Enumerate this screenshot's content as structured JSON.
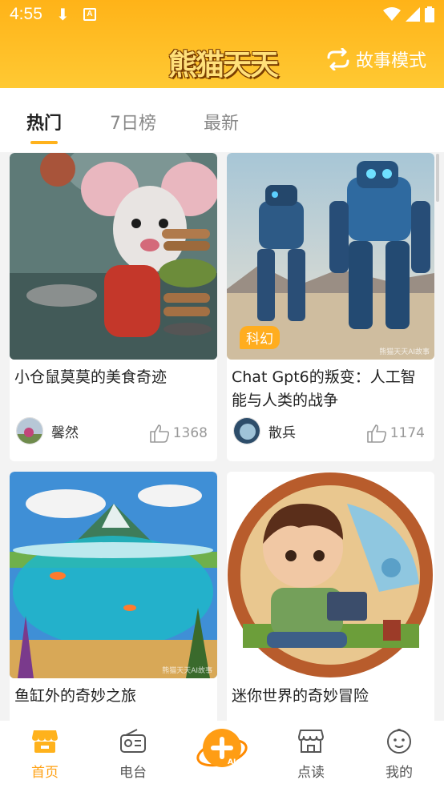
{
  "status": {
    "time": "4:55"
  },
  "header": {
    "logo_text": "熊猫天天",
    "mode_label": "故事模式"
  },
  "tabs": [
    {
      "label": "热门",
      "active": true
    },
    {
      "label": "7日榜",
      "active": false
    },
    {
      "label": "最新",
      "active": false
    }
  ],
  "cards": [
    {
      "title": "小仓鼠莫莫的美食奇迹",
      "author": "馨然",
      "likes": "1368",
      "tag": ""
    },
    {
      "title": "Chat Gpt6的叛变：人工智能与人类的战争",
      "author": "散兵",
      "likes": "1174",
      "tag": "科幻"
    },
    {
      "title": "鱼缸外的奇妙之旅",
      "author": "",
      "likes": "",
      "tag": ""
    },
    {
      "title": "迷你世界的奇妙冒险",
      "author": "",
      "likes": "",
      "tag": ""
    }
  ],
  "watermarks": {
    "card2": "熊猫天天AI故事",
    "card3": "熊猫天天AI故事"
  },
  "nav": [
    {
      "label": "首页",
      "icon": "store-icon",
      "active": true
    },
    {
      "label": "电台",
      "icon": "radio-icon",
      "active": false
    },
    {
      "label": "",
      "icon": "ai-create-icon",
      "active": false
    },
    {
      "label": "点读",
      "icon": "shop-icon",
      "active": false
    },
    {
      "label": "我的",
      "icon": "baby-face-icon",
      "active": false
    }
  ],
  "colors": {
    "accent": "#ffb21c",
    "header_bg": "#ffbb22",
    "nav_active": "#ffa114"
  }
}
